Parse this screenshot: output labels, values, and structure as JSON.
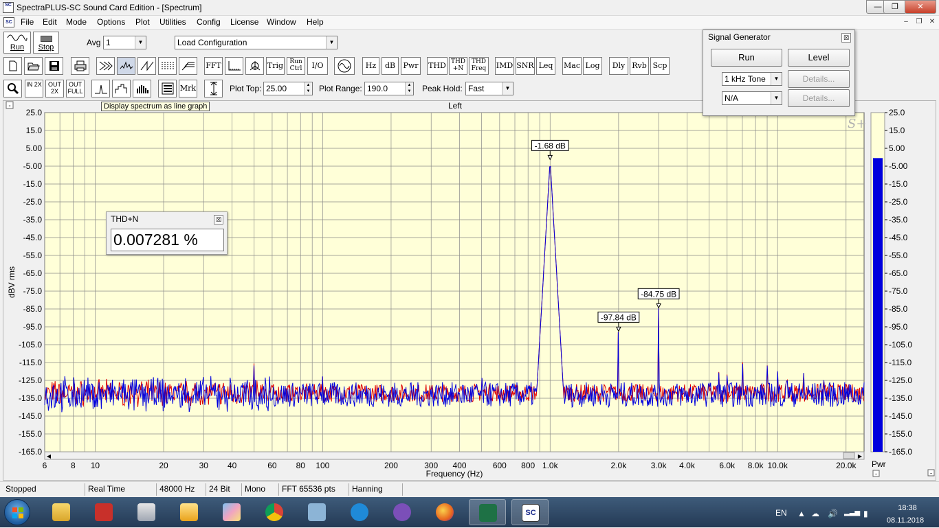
{
  "window": {
    "title": "SpectraPLUS-SC Sound Card Edition - [Spectrum]",
    "app_icon_text": "SC",
    "min": "—",
    "max": "❐",
    "close": "✕"
  },
  "menu": [
    "File",
    "Edit",
    "Mode",
    "Options",
    "Plot",
    "Utilities",
    "Config",
    "License",
    "Window",
    "Help"
  ],
  "mdi_buttons": [
    "–",
    "❐",
    "✕"
  ],
  "toolbar1": {
    "run_label": "Run",
    "stop_label": "Stop",
    "avg_label": "Avg",
    "avg_value": "1",
    "config_value": "Load Configuration"
  },
  "toolbar2": [
    "FFT",
    "Trig",
    "Run Ctrl",
    "I/O",
    "Hz",
    "dB",
    "Pwr",
    "THD",
    "THD +N",
    "THD Freq",
    "IMD",
    "SNR",
    "Leq",
    "Mac",
    "Log",
    "Dly",
    "Rvb",
    "Scp"
  ],
  "toolbar3": {
    "zoom_in": "IN 2X",
    "zoom_out": "OUT 2X",
    "zoom_full": "OUT FULL",
    "marker": "Mrk",
    "plot_top_label": "Plot Top:",
    "plot_top_value": "25.00",
    "plot_range_label": "Plot Range:",
    "plot_range_value": "190.0",
    "peak_hold_label": "Peak Hold:",
    "peak_hold_value": "Fast"
  },
  "tooltip": "Display spectrum as line graph",
  "plot": {
    "channel_title": "Left",
    "collapse": "-",
    "bar_label": "Pwr",
    "bar_collapse": "-",
    "watermark": "S+"
  },
  "chart_data": {
    "type": "line",
    "title": "Left",
    "xlabel": "Frequency (Hz)",
    "ylabel": "dBV rms",
    "x_scale": "log",
    "xlim": [
      6,
      24000
    ],
    "ylim": [
      -165,
      25
    ],
    "grid": true,
    "x_ticks": [
      6,
      8,
      10,
      20,
      30,
      40,
      60,
      80,
      100,
      200,
      300,
      400,
      600,
      800,
      1000,
      2000,
      3000,
      4000,
      6000,
      8000,
      10000,
      20000
    ],
    "x_tick_labels": [
      "6",
      "8",
      "10",
      "20",
      "30",
      "40",
      "60",
      "80",
      "100",
      "200",
      "300",
      "400",
      "600",
      "800",
      "1.0k",
      "2.0k",
      "3.0k",
      "4.0k",
      "6.0k",
      "8.0k",
      "10.0k",
      "20.0k"
    ],
    "y_ticks": [
      25,
      15,
      5,
      -5,
      -15,
      -25,
      -35,
      -45,
      -55,
      -65,
      -75,
      -85,
      -95,
      -105,
      -115,
      -125,
      -135,
      -145,
      -155,
      -165
    ],
    "y_tick_labels": [
      "25.0",
      "15.0",
      "5.00",
      "-5.00",
      "-15.0",
      "-25.0",
      "-35.0",
      "-45.0",
      "-55.0",
      "-65.0",
      "-75.0",
      "-85.0",
      "-95.0",
      "-105.0",
      "-115.0",
      "-125.0",
      "-135.0",
      "-145.0",
      "-155.0",
      "-165.0"
    ],
    "right_tick_labels": [
      "25.0",
      "15.0",
      "5.00",
      "-5.00",
      "-15.0",
      "-25.0",
      "-35.0",
      "-45.0",
      "-55.0",
      "-65.0",
      "-75.0",
      "-85.0",
      "-95.0",
      "-105.0",
      "-115.0",
      "-125.0",
      "-135.0",
      "-145.0",
      "-155.0",
      "-165.0"
    ],
    "series_colors": {
      "red": "#dd0000",
      "blue": "#0000dd"
    },
    "background": "#ffffd8",
    "peaks": [
      {
        "freq": 1000,
        "level": -1.68,
        "label": "-1.68 dB"
      },
      {
        "freq": 2000,
        "level": -97.84,
        "label": "-97.84 dB"
      },
      {
        "freq": 3000,
        "level": -84.75,
        "label": "-84.75 dB"
      }
    ],
    "noise_floor": -133,
    "minor_spikes": [
      {
        "freq": 50,
        "level": -116
      },
      {
        "freq": 100,
        "level": -123
      },
      {
        "freq": 500,
        "level": -124
      },
      {
        "freq": 5000,
        "level": -127
      },
      {
        "freq": 5500,
        "level": -121
      },
      {
        "freq": 6000,
        "level": -122
      },
      {
        "freq": 7000,
        "level": -115
      },
      {
        "freq": 9000,
        "level": -117
      },
      {
        "freq": 10000,
        "level": -120
      },
      {
        "freq": 11000,
        "level": -125
      },
      {
        "freq": 13000,
        "level": -121
      },
      {
        "freq": 16000,
        "level": -125
      }
    ],
    "power_bar_level": -0.5
  },
  "thd_panel": {
    "title": "THD+N",
    "value": "0.007281 %",
    "close": "☒"
  },
  "signal_generator": {
    "title": "Signal Generator",
    "run": "Run",
    "level": "Level",
    "tone": "1 kHz Tone",
    "channel2": "N/A",
    "details1": "Details...",
    "details2": "Details...",
    "close": "☒"
  },
  "status": [
    "Stopped",
    "Real Time",
    "48000 Hz",
    "24 Bit",
    "Mono",
    "FFT 65536 pts",
    "Hanning"
  ],
  "tray": {
    "lang": "EN",
    "time": "18:38",
    "date": "08.11.2018"
  }
}
